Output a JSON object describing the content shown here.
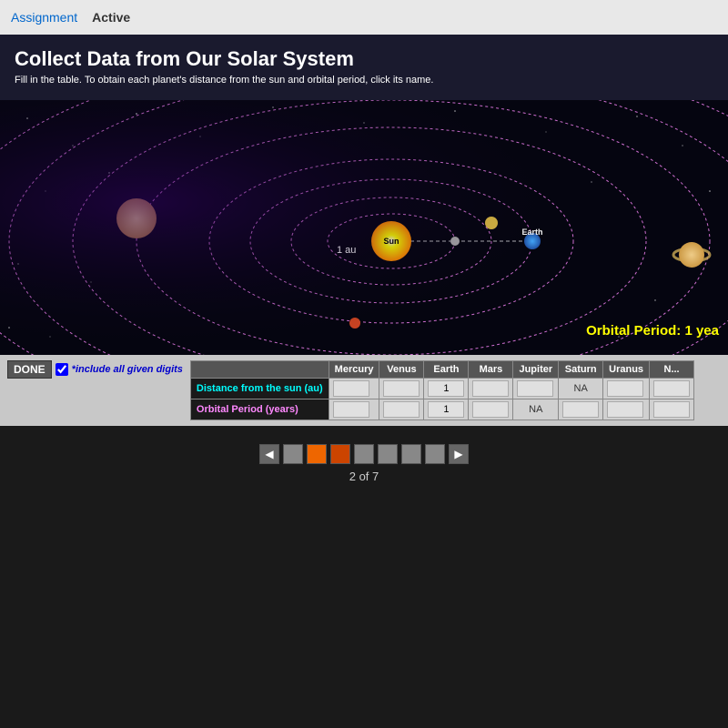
{
  "topbar": {
    "assignment_label": "Assignment",
    "active_label": "Active"
  },
  "page": {
    "title": "Collect Data from Our Solar System",
    "instruction": "Fill in the table. To obtain each planet's distance from the sun and orbital period, click its name.",
    "orbital_period_text": "Orbital Period: 1 yea",
    "au_label": "1 au"
  },
  "done_section": {
    "done_label": "DONE",
    "include_label": "*include all given digits"
  },
  "table": {
    "columns": [
      "Mercury",
      "Venus",
      "Earth",
      "Mars",
      "Jupiter",
      "Saturn",
      "Uranus",
      "N..."
    ],
    "row1_label": "Distance from the sun (au)",
    "row2_label": "Orbital Period (years)",
    "row1_values": [
      "",
      "",
      "1",
      "",
      "",
      "NA",
      "",
      ""
    ],
    "row2_values": [
      "",
      "",
      "1",
      "",
      "NA",
      "",
      "",
      ""
    ]
  },
  "pagination": {
    "current": "2",
    "total": "7",
    "counter_text": "2 of 7"
  },
  "solar_system": {
    "sun_label": "Sun",
    "earth_label": "Earth"
  }
}
